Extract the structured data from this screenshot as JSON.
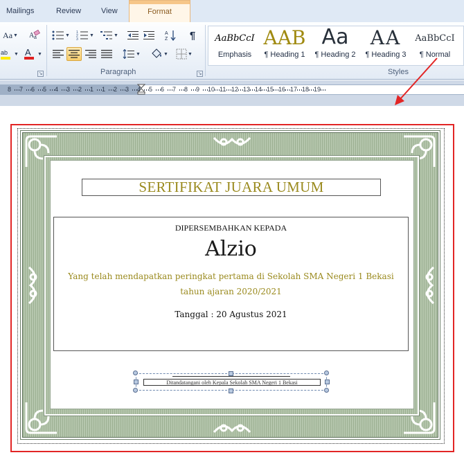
{
  "ribbon": {
    "tabs": [
      {
        "label": "Mailings"
      },
      {
        "label": "Review"
      },
      {
        "label": "View"
      },
      {
        "label": "Format",
        "active": true
      }
    ],
    "font_group": {
      "change_case_label": "Aa"
    },
    "paragraph": {
      "label": "Paragraph",
      "pilcrow": "¶"
    },
    "styles": {
      "label": "Styles",
      "items": [
        {
          "sample": "AaBbCcI",
          "name": "Emphasis"
        },
        {
          "sample": "AAB",
          "name": "¶ Heading 1"
        },
        {
          "sample": "Aa",
          "name": "¶ Heading 2"
        },
        {
          "sample": "AA",
          "name": "¶ Heading 3"
        },
        {
          "sample": "AaBbCcI",
          "name": "¶ Normal"
        }
      ]
    }
  },
  "ruler": {
    "numbers": [
      "8",
      "7",
      "6",
      "5",
      "4",
      "3",
      "2",
      "1",
      "1",
      "2",
      "3",
      "4",
      "5",
      "6",
      "7",
      "8",
      "9",
      "10",
      "11",
      "12",
      "13",
      "14",
      "15",
      "16",
      "17",
      "18",
      "19"
    ]
  },
  "certificate": {
    "title": "SERTIFIKAT JUARA UMUM",
    "dedication": "DIPERSEMBAHKAN KEPADA",
    "recipient": "Alzio",
    "achievement_line1": "Yang telah mendapatkan peringkat pertama di Sekolah SMA Negeri 1 Bekasi",
    "achievement_line2": "tahun ajaran 2020/2021",
    "date": "Tanggal : 20 Agustus 2021",
    "signature_caption": "Ditandatangani  oleh  Kepala Sekolah  SMA Negeri 1 Bekasi"
  },
  "colors": {
    "accent_gold": "#9a8a1e",
    "border_green": "#9cb092",
    "annotation_red": "#e22525",
    "ribbon_blue": "#dfe9f5"
  }
}
